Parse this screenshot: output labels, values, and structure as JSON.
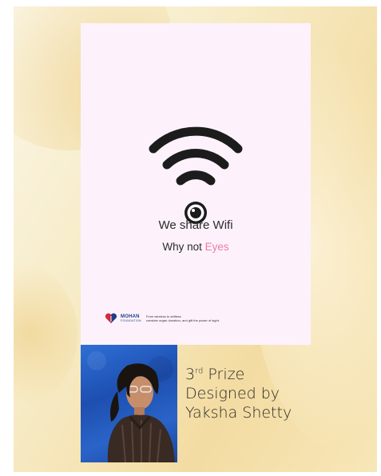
{
  "poster": {
    "headline": "We share Wifi",
    "subline_prefix": "Why not ",
    "subline_accent": "Eyes",
    "accent_color": "#f07aa8",
    "background_color": "#fdf2fb",
    "icon": "wifi-eye-icon",
    "footer": {
      "logo_icon": "heart-logo-icon",
      "org_name": "MOHAN",
      "org_sub": "FOUNDATION",
      "tagline_line1": "From wireless to selfless",
      "tagline_line2": "consider organ donation, and gift the power of sight."
    }
  },
  "caption": {
    "prize_number": "3",
    "prize_suffix": "rd",
    "prize_word": " Prize",
    "designed_by": "Designed by",
    "designer_name": "Yaksha Shetty"
  },
  "photo": {
    "description_icon": "designer-portrait"
  }
}
